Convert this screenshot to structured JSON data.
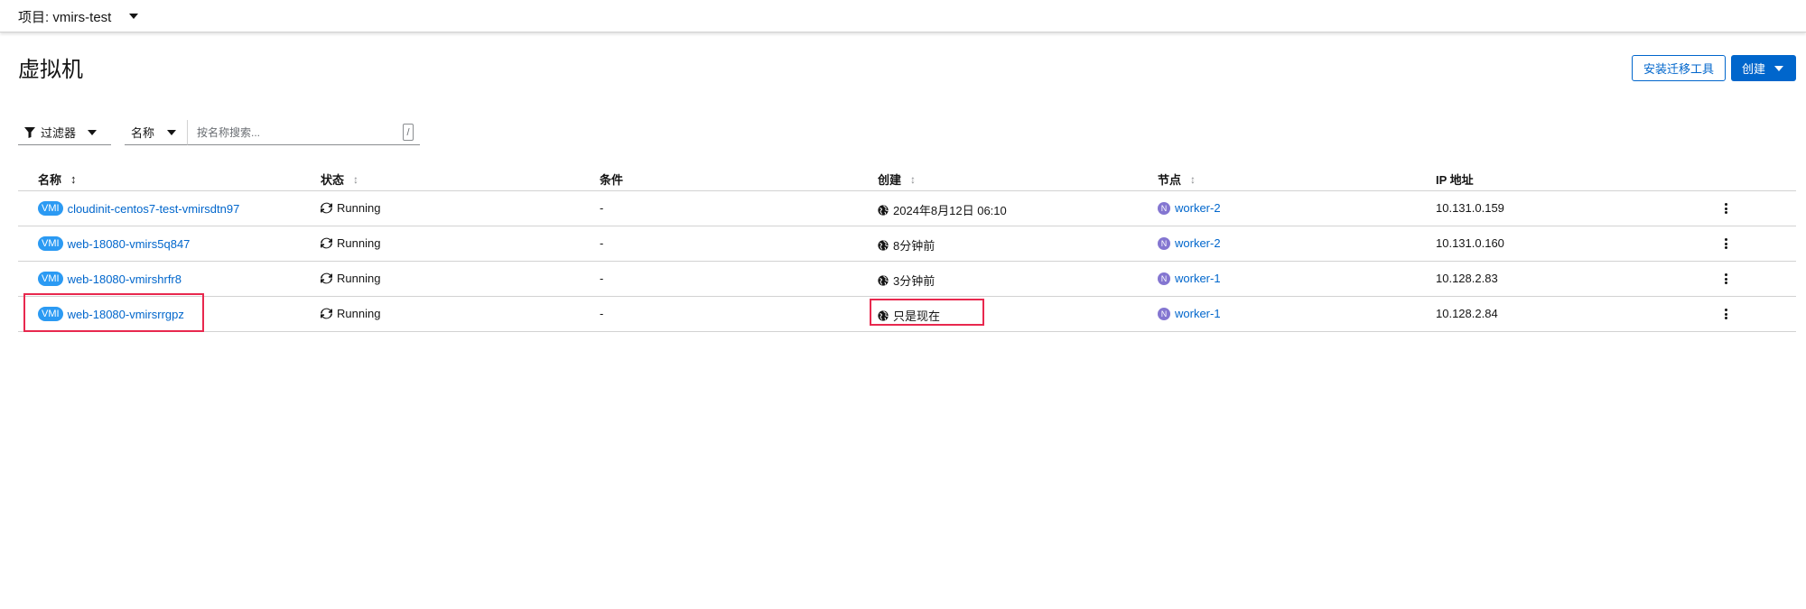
{
  "masthead": {
    "project_label": "项目: vmirs-test"
  },
  "page": {
    "title": "虚拟机",
    "install_button": "安装迁移工具",
    "create_button": "创建"
  },
  "toolbar": {
    "filter_label": "过滤器",
    "name_select_label": "名称",
    "search_placeholder": "按名称搜索...",
    "search_shortcut": "/"
  },
  "table": {
    "headers": {
      "name": "名称",
      "status": "状态",
      "conditions": "条件",
      "created": "创建",
      "node": "节点",
      "ip": "IP 地址"
    },
    "rows": [
      {
        "badge": "VMI",
        "name": "cloudinit-centos7-test-vmirsdtn97",
        "status": "Running",
        "conditions": "-",
        "created": "2024年8月12日 06:10",
        "node_badge": "N",
        "node": "worker-2",
        "ip": "10.131.0.159"
      },
      {
        "badge": "VMI",
        "name": "web-18080-vmirs5q847",
        "status": "Running",
        "conditions": "-",
        "created": "8分钟前",
        "node_badge": "N",
        "node": "worker-2",
        "ip": "10.131.0.160"
      },
      {
        "badge": "VMI",
        "name": "web-18080-vmirshrfr8",
        "status": "Running",
        "conditions": "-",
        "created": "3分钟前",
        "node_badge": "N",
        "node": "worker-1",
        "ip": "10.128.2.83"
      },
      {
        "badge": "VMI",
        "name": "web-18080-vmirsrrgpz",
        "status": "Running",
        "conditions": "-",
        "created": "只是现在",
        "node_badge": "N",
        "node": "worker-1",
        "ip": "10.128.2.84"
      }
    ]
  },
  "colors": {
    "link": "#0066cc",
    "primary": "#0066cc",
    "vmi_badge": "#2b9af3",
    "node_badge": "#8476d1",
    "highlight": "#e8284e"
  }
}
